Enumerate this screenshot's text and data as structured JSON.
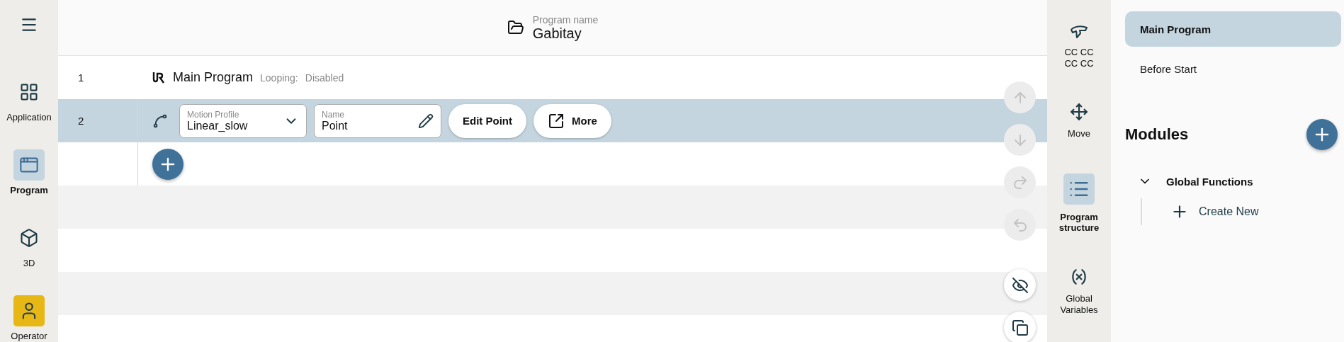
{
  "left_sidebar": {
    "items": [
      {
        "label": "Application",
        "kind": "grid",
        "selected": false
      },
      {
        "label": "Program",
        "kind": "program",
        "selected": true
      },
      {
        "label": "3D",
        "kind": "cube",
        "selected": false
      },
      {
        "label": "Operator",
        "kind": "user",
        "selected": false
      }
    ]
  },
  "header": {
    "label": "Program name",
    "value": "Gabitay"
  },
  "program": {
    "rows": [
      {
        "kind": "main",
        "number": "1",
        "title": "Main Program",
        "looping_label": "Looping:",
        "looping_value": "Disabled",
        "selected": false
      },
      {
        "kind": "move",
        "number": "2",
        "selected": true,
        "motion_profile": {
          "label": "Motion Profile",
          "value": "Linear_slow"
        },
        "name_field": {
          "label": "Name",
          "value": "Point"
        },
        "buttons": [
          {
            "label": "Edit Point",
            "kind": "plain"
          },
          {
            "label": "More",
            "kind": "external"
          }
        ]
      },
      {
        "kind": "add",
        "selected": false
      }
    ]
  },
  "floating_actions": [
    {
      "kind": "up",
      "disabled": true
    },
    {
      "kind": "down",
      "disabled": true
    },
    {
      "kind": "redo",
      "disabled": true
    },
    {
      "kind": "undo",
      "disabled": true
    },
    {
      "kind": "hide",
      "disabled": false
    },
    {
      "kind": "copy",
      "disabled": false
    }
  ],
  "right_toolbar": {
    "items": [
      {
        "label": "CC CC\nCC CC",
        "kind": "gripper",
        "selected": false
      },
      {
        "label": "Move",
        "kind": "move",
        "selected": false
      },
      {
        "label": "Program structure",
        "kind": "structure",
        "selected": true
      },
      {
        "label": "Global Variables",
        "kind": "variables",
        "selected": false
      }
    ]
  },
  "structure_panel": {
    "tabs": [
      {
        "label": "Main Program",
        "selected": true
      },
      {
        "label": "Before Start",
        "selected": false
      }
    ],
    "modules_title": "Modules",
    "tree": [
      {
        "label": "Global Functions",
        "expanded": true,
        "children": [
          {
            "label": "Create New",
            "kind": "create"
          }
        ]
      }
    ]
  }
}
